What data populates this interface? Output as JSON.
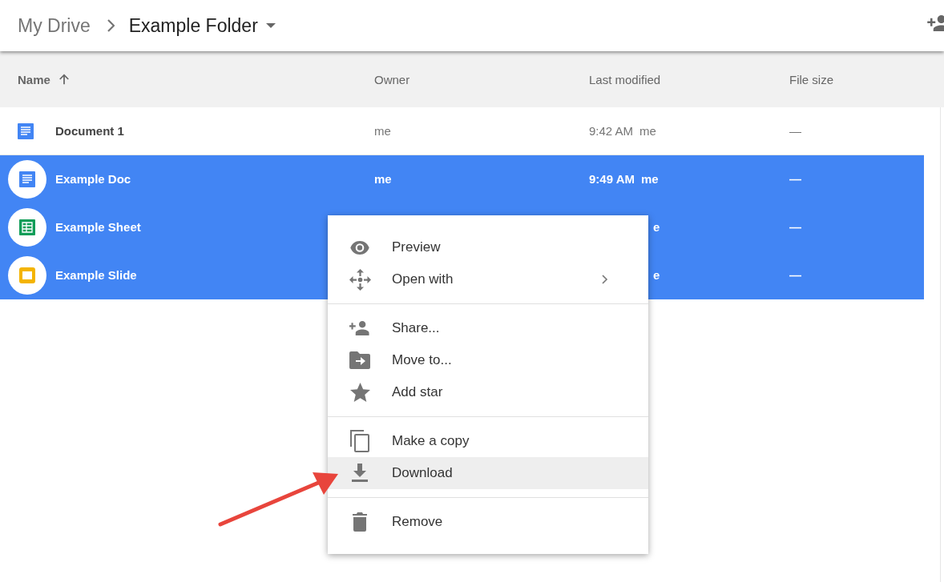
{
  "breadcrumb": {
    "root": "My Drive",
    "current": "Example Folder"
  },
  "table": {
    "columns": [
      {
        "label": "Name",
        "sorted": true
      },
      {
        "label": "Owner",
        "sorted": false
      },
      {
        "label": "Last modified",
        "sorted": false
      },
      {
        "label": "File size",
        "sorted": false
      }
    ],
    "rows": [
      {
        "kind": "doc",
        "name": "Document 1",
        "selected": false,
        "owner": "me",
        "modified": "9:42 AM",
        "modified_by": "me",
        "size": "—"
      },
      {
        "kind": "doc",
        "name": "Example Doc",
        "selected": true,
        "owner": "me",
        "modified": "9:49 AM",
        "modified_by": "me",
        "size": "—"
      },
      {
        "kind": "sheet",
        "name": "Example Sheet",
        "selected": true,
        "modified_by": "e",
        "size": "—"
      },
      {
        "kind": "slide",
        "name": "Example Slide",
        "selected": true,
        "modified_by": "e",
        "size": "—"
      }
    ]
  },
  "context_menu": {
    "sections": [
      [
        {
          "kind": "eye",
          "label": "Preview",
          "highlighted": false,
          "submenu": false
        },
        {
          "kind": "move",
          "label": "Open with",
          "highlighted": false,
          "submenu": true
        }
      ],
      [
        {
          "kind": "person-add",
          "label": "Share...",
          "highlighted": false,
          "submenu": false
        },
        {
          "kind": "folder",
          "label": "Move to...",
          "highlighted": false,
          "submenu": false
        },
        {
          "kind": "star",
          "label": "Add star",
          "highlighted": false,
          "submenu": false
        }
      ],
      [
        {
          "kind": "copy",
          "label": "Make a copy",
          "highlighted": false,
          "submenu": false
        },
        {
          "kind": "download",
          "label": "Download",
          "highlighted": true,
          "submenu": false
        }
      ],
      [
        {
          "kind": "trash",
          "label": "Remove",
          "highlighted": false,
          "submenu": false
        }
      ]
    ]
  }
}
